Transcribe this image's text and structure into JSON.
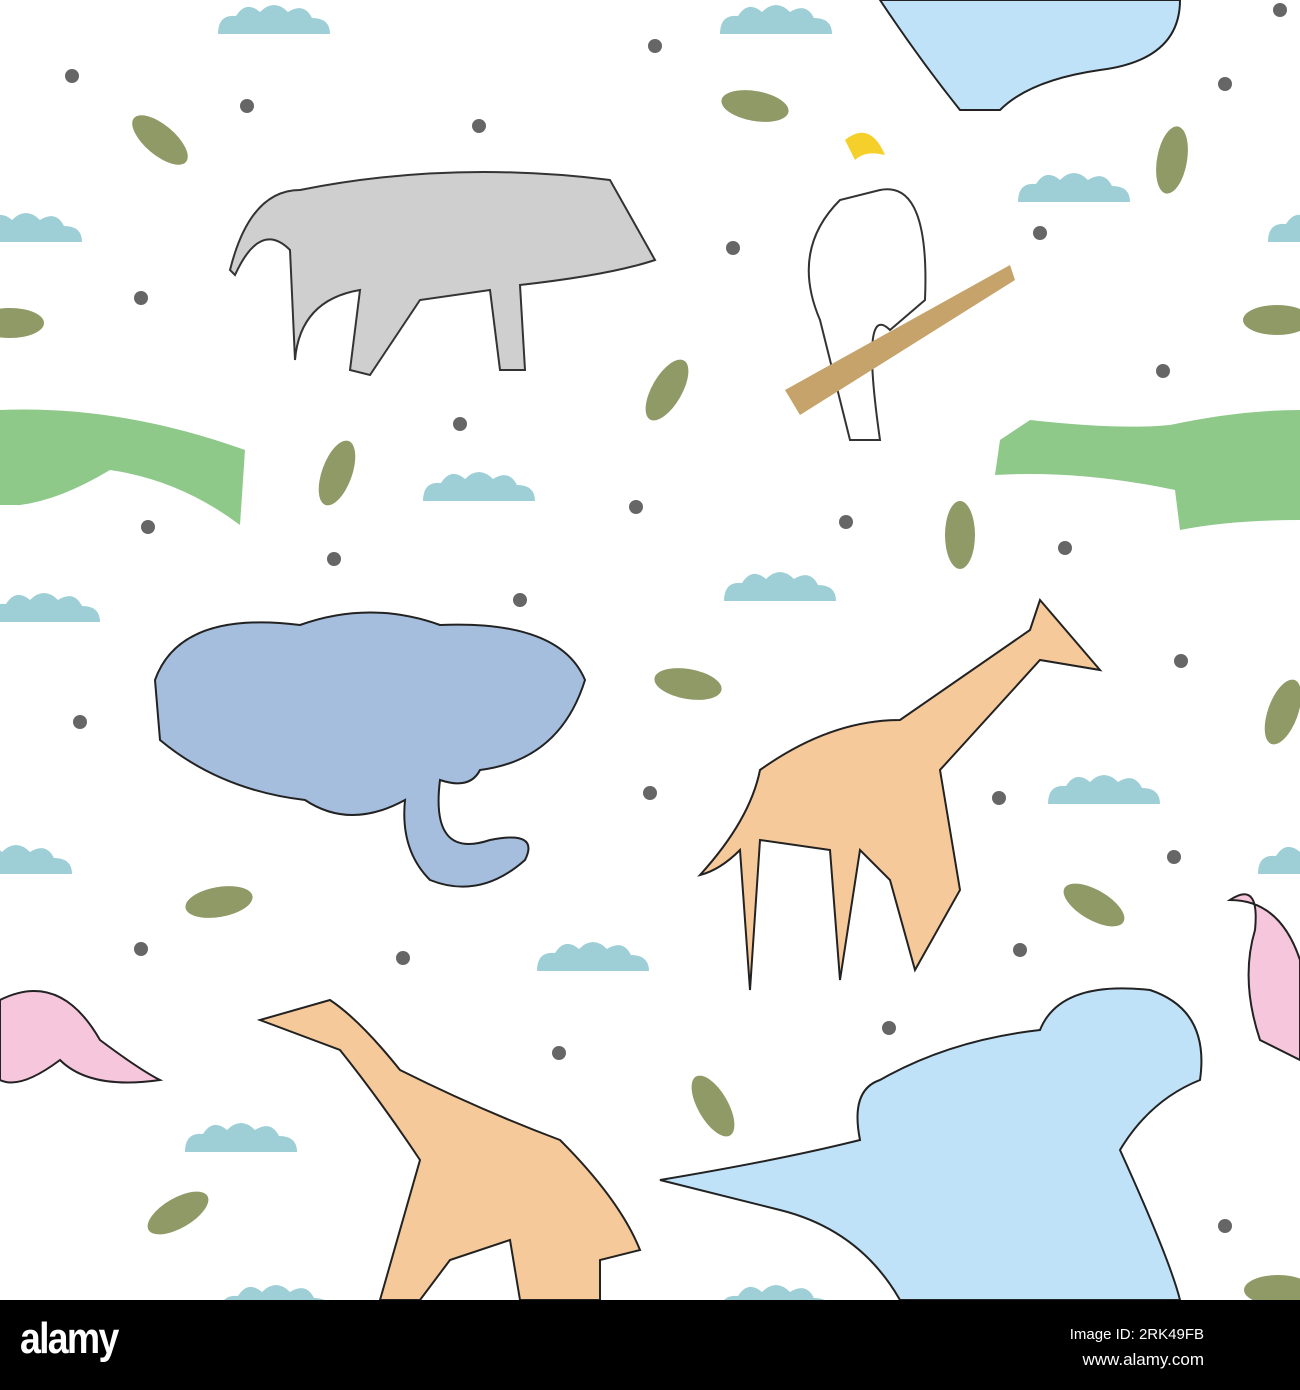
{
  "colors": {
    "cloud": "#9fcfd6",
    "dot": "#666666",
    "leaf": "#8f9a67",
    "croc": "#8ec98a",
    "elephant": "#a6bedd",
    "giraffe": "#f6c99a",
    "hippo": "#bfe2f8",
    "flamingo": "#f6c6dc",
    "zebra": "#cfcfcf",
    "branch": "#c5a36a",
    "crest": "#f5cf2a"
  },
  "footer": {
    "logo": "alamy",
    "image_id": "Image ID: 2RK49FB",
    "url": "www.alamy.com"
  }
}
